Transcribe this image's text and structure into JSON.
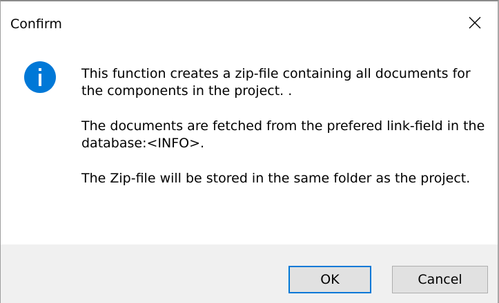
{
  "dialog": {
    "title": "Confirm",
    "icon": "info-icon",
    "accent_color": "#0078d7"
  },
  "message": {
    "paragraphs": [
      "This function creates a zip-file containing all documents for the components in the project. .",
      "The documents are fetched from the prefered link-field in the database:<INFO>.",
      "The Zip-file will be stored in the same folder as the project."
    ]
  },
  "buttons": {
    "ok_label": "OK",
    "cancel_label": "Cancel"
  }
}
